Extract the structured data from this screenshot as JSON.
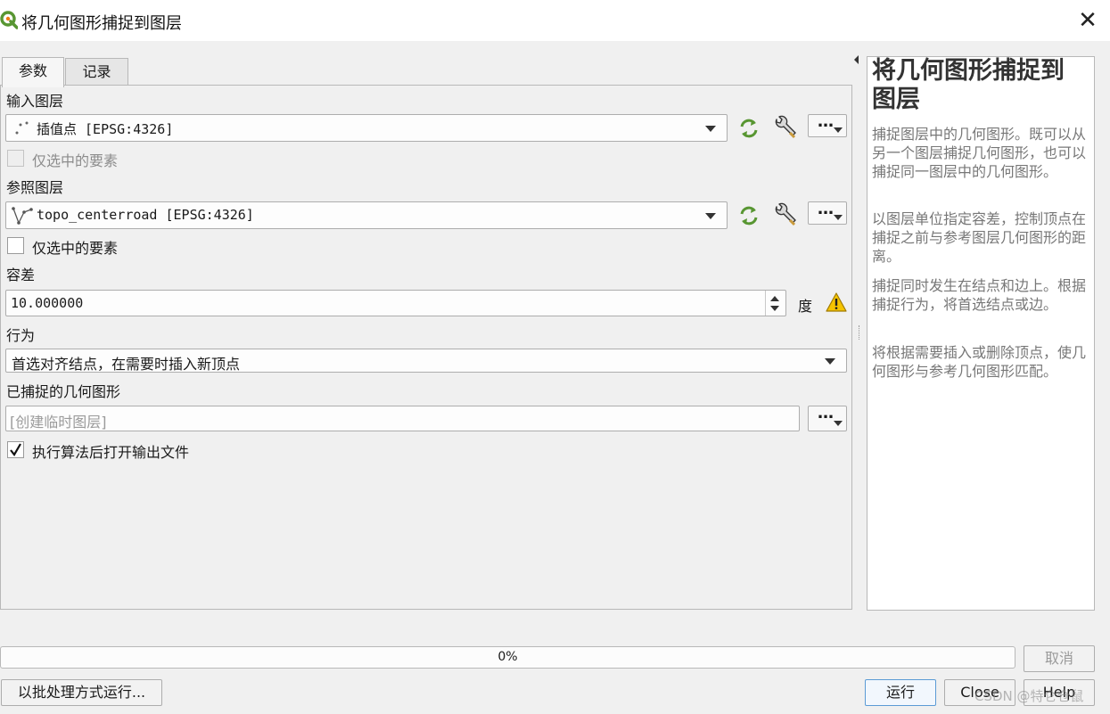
{
  "window": {
    "title": "将几何图形捕捉到图层",
    "close_glyph": "✕"
  },
  "tabs": [
    {
      "label": "参数"
    },
    {
      "label": "记录"
    }
  ],
  "form": {
    "input_layer": {
      "label": "输入图层",
      "value": "插值点 [EPSG:4326]",
      "selected_only_label": "仅选中的要素",
      "selected_only_checked": false,
      "selected_only_enabled": false
    },
    "reference_layer": {
      "label": "参照图层",
      "value": "topo_centerroad [EPSG:4326]",
      "selected_only_label": "仅选中的要素",
      "selected_only_checked": false
    },
    "tolerance": {
      "label": "容差",
      "value": "10.000000",
      "unit": "度"
    },
    "behavior": {
      "label": "行为",
      "value": "首选对齐结点，在需要时插入新顶点"
    },
    "output": {
      "label": "已捕捉的几何图形",
      "placeholder": "[创建临时图层]"
    },
    "open_output": {
      "label": "执行算法后打开输出文件",
      "checked": true
    },
    "dots": "…"
  },
  "help": {
    "title": "将几何图形捕捉到图层",
    "paragraphs": [
      "捕捉图层中的几何图形。既可以从另一个图层捕捉几何图形，也可以捕捉同一图层中的几何图形。",
      "以图层单位指定容差，控制顶点在捕捉之前与参考图层几何图形的距离。",
      "捕捉同时发生在结点和边上。根据捕捉行为，将首选结点或边。",
      "将根据需要插入或删除顶点，使几何图形与参考几何图形匹配。"
    ]
  },
  "progress": {
    "value": 0,
    "text": "0%"
  },
  "buttons": {
    "cancel": "取消",
    "batch": "以批处理方式运行...",
    "run": "运行",
    "close": "Close",
    "help": "Help"
  },
  "watermark": "CSDN @特仑仓鼠",
  "colors": {
    "qgis_green": "#589632",
    "qgis_yellow": "#ee7913",
    "warning_yellow": "#f5c400",
    "help_text": "#777777"
  }
}
